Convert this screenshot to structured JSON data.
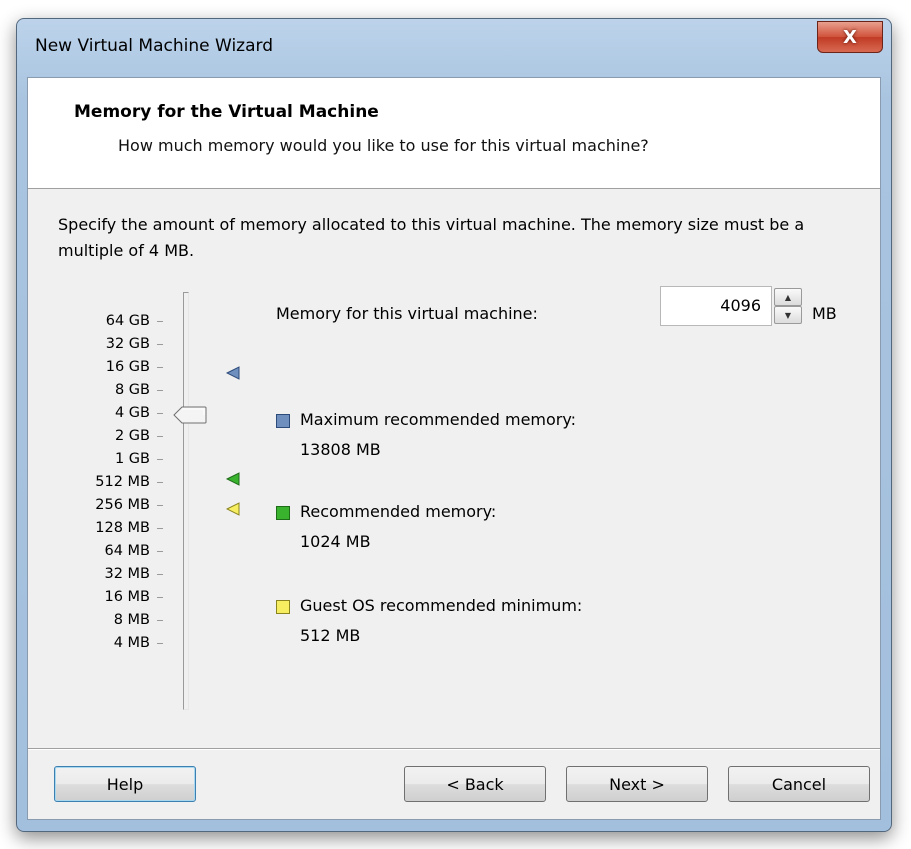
{
  "window": {
    "title": "New Virtual Machine Wizard",
    "close_glyph": "X"
  },
  "header": {
    "title": "Memory for the Virtual Machine",
    "subtitle": "How much memory would you like to use for this virtual machine?"
  },
  "description": "Specify the amount of memory allocated to this virtual machine. The memory size must be a multiple of 4 MB.",
  "scale": {
    "labels": [
      "64 GB",
      "32 GB",
      "16 GB",
      "8 GB",
      "4 GB",
      "2 GB",
      "1 GB",
      "512 MB",
      "256 MB",
      "128 MB",
      "64 MB",
      "32 MB",
      "16 MB",
      "8 MB",
      "4 MB"
    ],
    "selected": "4 GB"
  },
  "memory": {
    "label": "Memory for this virtual machine:",
    "value": "4096",
    "unit": "MB"
  },
  "legend": {
    "max": {
      "label": "Maximum recommended memory:",
      "value": "13808 MB",
      "color": "#6f8fbf"
    },
    "recommended": {
      "label": "Recommended memory:",
      "value": "1024 MB",
      "color": "#39b22e"
    },
    "guest_min": {
      "label": "Guest OS recommended minimum:",
      "value": "512 MB",
      "color": "#f6ee60"
    }
  },
  "buttons": {
    "help": "Help",
    "back": "< Back",
    "next": "Next >",
    "cancel": "Cancel"
  }
}
